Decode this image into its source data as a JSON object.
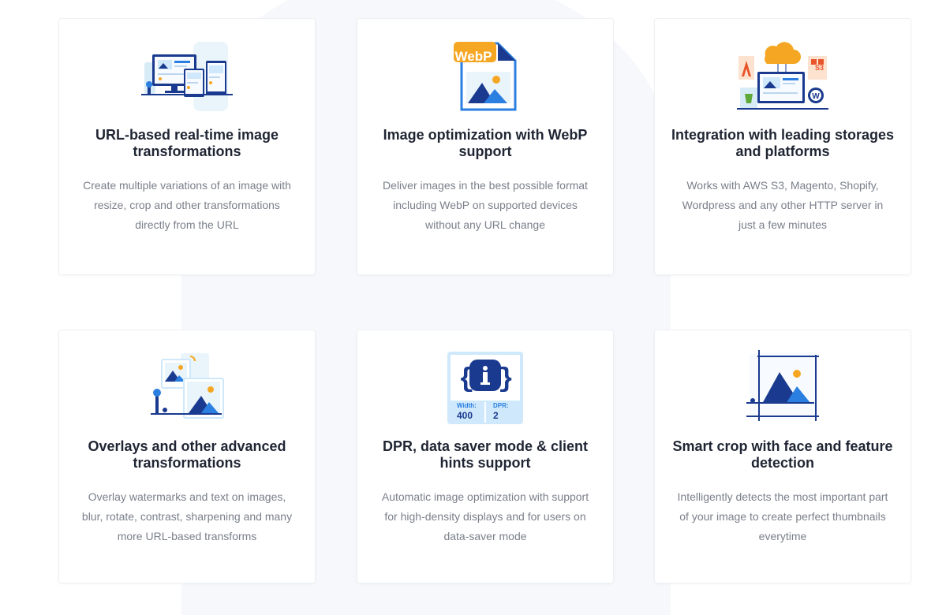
{
  "features": [
    {
      "title": "URL-based real-time image transformations",
      "desc": "Create multiple variations of an image with resize, crop and other transformations directly from the URL",
      "icon": "devices-icon"
    },
    {
      "title": "Image optimization with WebP support",
      "desc": "Deliver images in the best possible format including WebP on supported devices without any URL change",
      "icon": "webp-file-icon",
      "badge": "WebP"
    },
    {
      "title": "Integration with leading storages and platforms",
      "desc": "Works with AWS S3, Magento, Shopify, Wordpress and any other HTTP server in just a few minutes",
      "icon": "integrations-icon",
      "badge": "S3"
    },
    {
      "title": "Overlays and other advanced transformations",
      "desc": "Overlay watermarks and text on images, blur, rotate, contrast, sharpening and many more URL-based transforms",
      "icon": "overlays-icon"
    },
    {
      "title": "DPR, data saver mode & client hints support",
      "desc": "Automatic image optimization with support for high-density displays and for users on data-saver mode",
      "icon": "client-hints-icon",
      "hint_width_label": "Width:",
      "hint_width_value": "400",
      "hint_dpr_label": "DPR:",
      "hint_dpr_value": "2"
    },
    {
      "title": "Smart crop with face and feature detection",
      "desc": "Intelligently detects the most important part of your image to create perfect thumbnails everytime",
      "icon": "smart-crop-icon"
    }
  ],
  "colors": {
    "navy": "#1a3a8f",
    "blue": "#2a7fe0",
    "light_blue": "#cfe8fb",
    "orange": "#f5a623",
    "title": "#1f2533",
    "text": "#7a7f8a"
  }
}
